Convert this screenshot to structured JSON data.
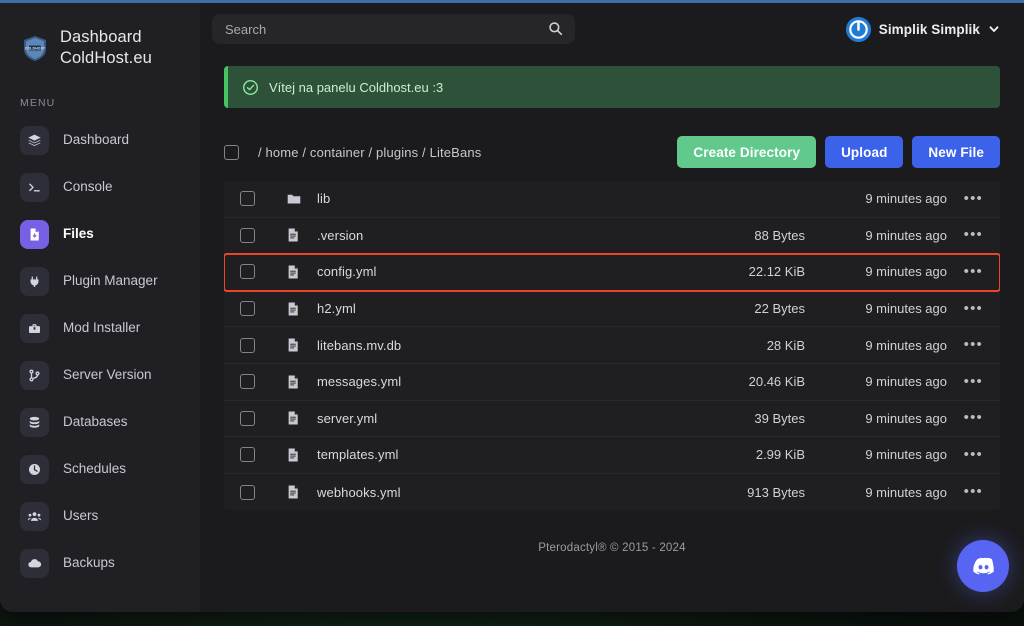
{
  "window": {
    "accent_bar_color": "#3d6fa8",
    "background_color": "#1b1b1d"
  },
  "sidebar": {
    "brand_title": "Dashboard ColdHost.eu",
    "brand_logo_icon": "coldhost-shield-logo",
    "menu_label": "MENU",
    "active_color": "#7760e4",
    "items": [
      {
        "label": "Dashboard",
        "icon": "layers-icon",
        "active": false
      },
      {
        "label": "Console",
        "icon": "terminal-icon",
        "active": false
      },
      {
        "label": "Files",
        "icon": "file-document-icon",
        "active": true
      },
      {
        "label": "Plugin Manager",
        "icon": "plug-icon",
        "active": false
      },
      {
        "label": "Mod Installer",
        "icon": "toolbox-icon",
        "active": false
      },
      {
        "label": "Server Version",
        "icon": "git-branch-icon",
        "active": false
      },
      {
        "label": "Databases",
        "icon": "database-icon",
        "active": false
      },
      {
        "label": "Schedules",
        "icon": "clock-icon",
        "active": false
      },
      {
        "label": "Users",
        "icon": "users-icon",
        "active": false
      },
      {
        "label": "Backups",
        "icon": "cloud-icon",
        "active": false
      }
    ]
  },
  "header": {
    "search_placeholder": "Search",
    "search_value": "",
    "search_icon": "search-icon",
    "user_name": "Simplik Simplik",
    "avatar_icon": "power-circle-avatar",
    "caret_icon": "chevron-down-icon"
  },
  "alert": {
    "icon": "check-circle-icon",
    "message": "Vítej na panelu Coldhost.eu :3",
    "accent_color": "#45c463",
    "background_color": "#2d5239"
  },
  "file_manager": {
    "select_all_checkbox": false,
    "breadcrumb": "/ home / container / plugins / LiteBans",
    "buttons": [
      {
        "label": "Create Directory",
        "style": "green"
      },
      {
        "label": "Upload",
        "style": "blue"
      },
      {
        "label": "New File",
        "style": "blue"
      }
    ],
    "row_menu_icon": "ellipsis-icon",
    "highlight_color": "#e8452a",
    "files": [
      {
        "name": "lib",
        "icon": "folder-icon",
        "size": "",
        "modified": "9 minutes ago",
        "highlighted": false
      },
      {
        "name": ".version",
        "icon": "file-icon",
        "size": "88 Bytes",
        "modified": "9 minutes ago",
        "highlighted": false
      },
      {
        "name": "config.yml",
        "icon": "file-icon",
        "size": "22.12 KiB",
        "modified": "9 minutes ago",
        "highlighted": true
      },
      {
        "name": "h2.yml",
        "icon": "file-icon",
        "size": "22 Bytes",
        "modified": "9 minutes ago",
        "highlighted": false
      },
      {
        "name": "litebans.mv.db",
        "icon": "file-icon",
        "size": "28 KiB",
        "modified": "9 minutes ago",
        "highlighted": false
      },
      {
        "name": "messages.yml",
        "icon": "file-icon",
        "size": "20.46 KiB",
        "modified": "9 minutes ago",
        "highlighted": false
      },
      {
        "name": "server.yml",
        "icon": "file-icon",
        "size": "39 Bytes",
        "modified": "9 minutes ago",
        "highlighted": false
      },
      {
        "name": "templates.yml",
        "icon": "file-icon",
        "size": "2.99 KiB",
        "modified": "9 minutes ago",
        "highlighted": false
      },
      {
        "name": "webhooks.yml",
        "icon": "file-icon",
        "size": "913 Bytes",
        "modified": "9 minutes ago",
        "highlighted": false
      }
    ]
  },
  "footer": {
    "text": "Pterodactyl® © 2015 - 2024"
  },
  "floating_action": {
    "icon": "discord-icon",
    "color": "#5865f2"
  }
}
